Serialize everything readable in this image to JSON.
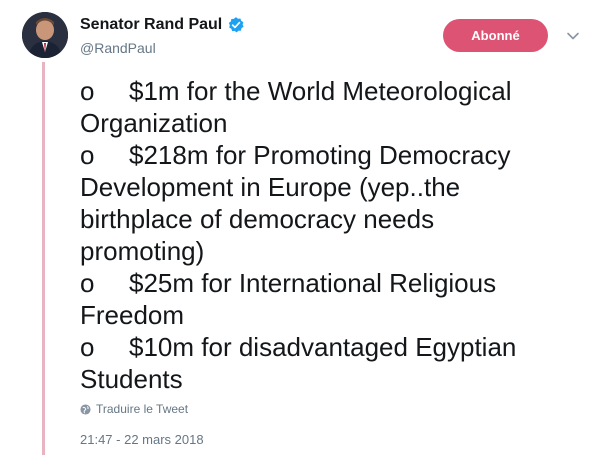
{
  "author": {
    "name": "Senator Rand Paul",
    "handle": "@RandPaul",
    "verified": true,
    "verified_color": "#1da1f2"
  },
  "follow_button": {
    "label": "Abonné",
    "color": "#dd5373"
  },
  "tweet": {
    "lines": [
      {
        "bullet": "o",
        "text": "$1m for the World Meteorological"
      },
      {
        "bullet": "",
        "text": "Organization"
      },
      {
        "bullet": "o",
        "text": "$218m for Promoting Democracy"
      },
      {
        "bullet": "",
        "text": "Development in Europe (yep..the"
      },
      {
        "bullet": "",
        "text": "birthplace of democracy needs"
      },
      {
        "bullet": "",
        "text": "promoting)"
      },
      {
        "bullet": "o",
        "text": "$25m for International Religious"
      },
      {
        "bullet": "",
        "text": "Freedom"
      },
      {
        "bullet": "o",
        "text": "$10m for disadvantaged Egyptian"
      },
      {
        "bullet": "",
        "text": "Students"
      }
    ]
  },
  "translate_label": "Traduire le Tweet",
  "timestamp": "21:47 - 22 mars 2018",
  "colors": {
    "thread_line": "#e8b4c1",
    "text_primary": "#14171a",
    "text_secondary": "#657786"
  },
  "icons": {
    "verified": "verified-badge-icon",
    "chevron": "chevron-down-icon",
    "translate": "globe-icon"
  }
}
